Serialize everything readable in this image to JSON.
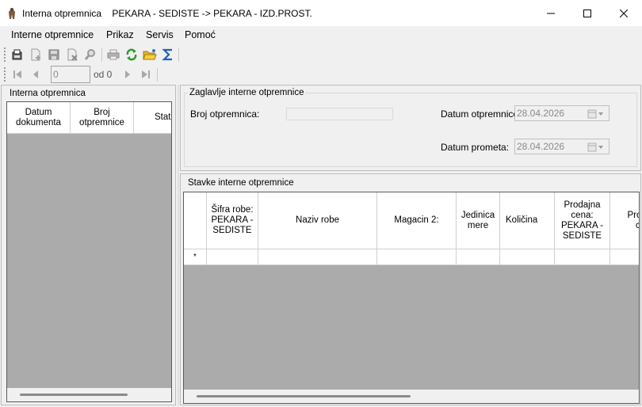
{
  "window": {
    "title": "Interna otpremnica    PEKARA - SEDISTE -> PEKARA - IZD.PROST."
  },
  "menu": [
    "Interne otpremnice",
    "Prikaz",
    "Servis",
    "Pomoć"
  ],
  "toolbar": {
    "icons": [
      "new-document-icon",
      "add-item-icon",
      "save-icon",
      "delete-icon",
      "search-icon",
      "print-icon",
      "refresh-icon",
      "open-folder-icon",
      "sum-icon"
    ]
  },
  "navigator": {
    "position_value": "0",
    "of_label": "od 0"
  },
  "left_panel": {
    "title": "Interna otpremnica",
    "columns": [
      "Datum dokumenta",
      "Broj otpremnice",
      "Status"
    ]
  },
  "header_panel": {
    "title": "Zaglavlje interne otpremnice",
    "broj_label": "Broj otpremnica:",
    "broj_value": "",
    "datum_otpremnice_label": "Datum otpremnice:",
    "datum_otpremnice_value": "28.04.2026",
    "datum_prometa_label": "Datum prometa:",
    "datum_prometa_value": "28.04.2026"
  },
  "items_panel": {
    "title": "Stavke interne otpremnice",
    "columns": [
      "Šifra robe: PEKARA - SEDISTE",
      "Naziv robe",
      "Magacin 2:",
      "Jedinica mere",
      "Količina",
      "Prodajna cena: PEKARA - SEDISTE",
      "Prodajna cena"
    ],
    "new_row_marker": "*"
  },
  "colors": {
    "grid_background": "#ababab",
    "window_background": "#f0f0f0",
    "sum_icon": "#1f5fbf",
    "refresh_icon": "#2e9b2e"
  }
}
